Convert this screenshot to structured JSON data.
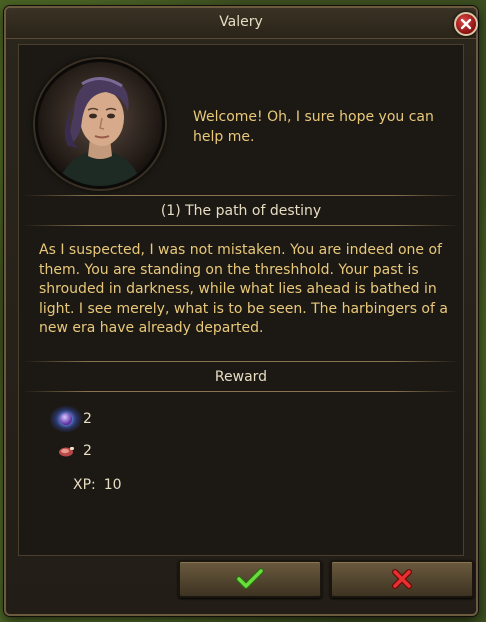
{
  "dialog": {
    "title": "Valery",
    "greeting": "Welcome! Oh, I sure hope you can help me."
  },
  "quest": {
    "heading": "(1)  The path of destiny",
    "text": "As I suspected, I was not mistaken. You are indeed one of them. You are standing on the threshhold. Your past is shrouded in darkness, while what lies ahead is bathed in light. I see merely, what is to be seen. The harbingers of a new era have already departed."
  },
  "reward": {
    "heading": "Reward",
    "items": [
      {
        "icon": "orb-icon",
        "amount": "2"
      },
      {
        "icon": "meat-icon",
        "amount": "2"
      }
    ],
    "xp_label": "XP:",
    "xp_value": "10"
  },
  "buttons": {
    "accept_icon": "checkmark-icon",
    "decline_icon": "cross-icon"
  },
  "colors": {
    "quest_text": "#e8c87a",
    "heading_text": "#e6dcc2",
    "accept": "#5cc83a",
    "decline": "#d82a2a",
    "close": "#c02828"
  }
}
